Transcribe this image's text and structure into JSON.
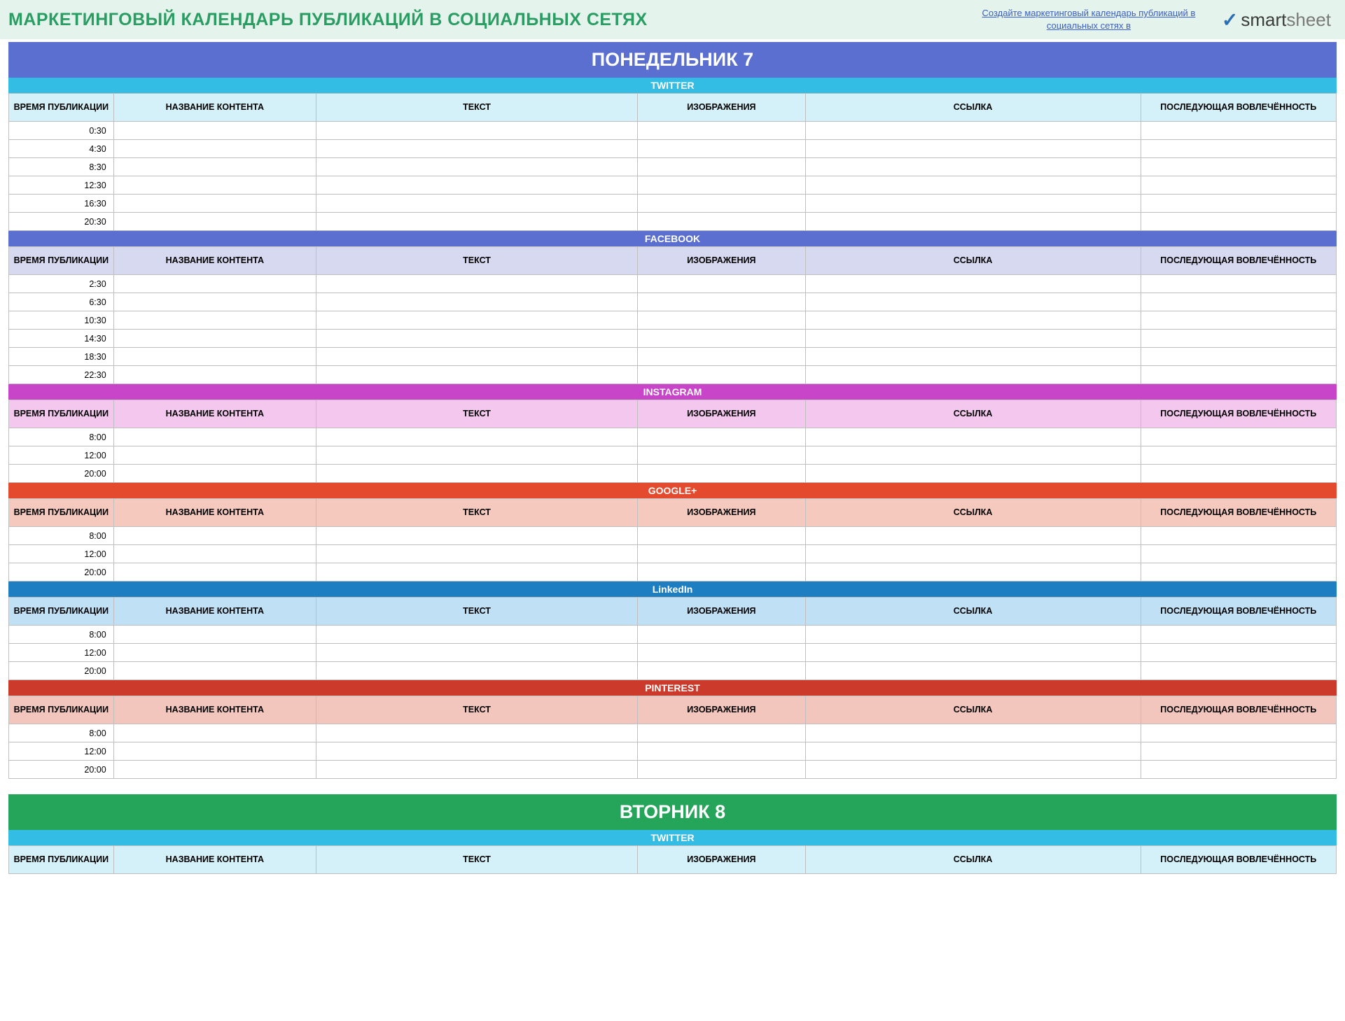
{
  "header": {
    "title": "МАРКЕТИНГОВЫЙ КАЛЕНДАРЬ ПУБЛИКАЦИЙ В СОЦИАЛЬНЫХ СЕТЯХ",
    "promo_link": "Создайте маркетинговый календарь публикаций в социальных сетях в",
    "logo_brand1": "smart",
    "logo_brand2": "sheet"
  },
  "columns": {
    "time": "ВРЕМЯ ПУБЛИКАЦИИ",
    "title": "НАЗВАНИЕ КОНТЕНТА",
    "text": "ТЕКСТ",
    "image": "ИЗОБРАЖЕНИЯ",
    "link": "ССЫЛКА",
    "engage": "ПОСЛЕДУЮЩАЯ ВОВЛЕЧЁННОСТЬ"
  },
  "days": [
    {
      "label": "ПОНЕДЕЛЬНИК   7",
      "band_class": "blue",
      "channels": [
        {
          "name": "TWITTER",
          "css": "ch-twitter",
          "hdr": "hdr-twitter",
          "times": [
            "0:30",
            "4:30",
            "8:30",
            "12:30",
            "16:30",
            "20:30"
          ]
        },
        {
          "name": "FACEBOOK",
          "css": "ch-facebook",
          "hdr": "hdr-facebook",
          "times": [
            "2:30",
            "6:30",
            "10:30",
            "14:30",
            "18:30",
            "22:30"
          ]
        },
        {
          "name": "INSTAGRAM",
          "css": "ch-instagram",
          "hdr": "hdr-instagram",
          "times": [
            "8:00",
            "12:00",
            "20:00"
          ]
        },
        {
          "name": "GOOGLE+",
          "css": "ch-google",
          "hdr": "hdr-google",
          "times": [
            "8:00",
            "12:00",
            "20:00"
          ]
        },
        {
          "name": "LinkedIn",
          "css": "ch-linkedin",
          "hdr": "hdr-linkedin",
          "times": [
            "8:00",
            "12:00",
            "20:00"
          ]
        },
        {
          "name": "PINTEREST",
          "css": "ch-pinterest",
          "hdr": "hdr-pinterest",
          "times": [
            "8:00",
            "12:00",
            "20:00"
          ]
        }
      ]
    },
    {
      "label": "ВТОРНИК   8",
      "band_class": "green",
      "channels": [
        {
          "name": "TWITTER",
          "css": "ch-twitter2",
          "hdr": "hdr-twitter",
          "times": []
        }
      ]
    }
  ]
}
